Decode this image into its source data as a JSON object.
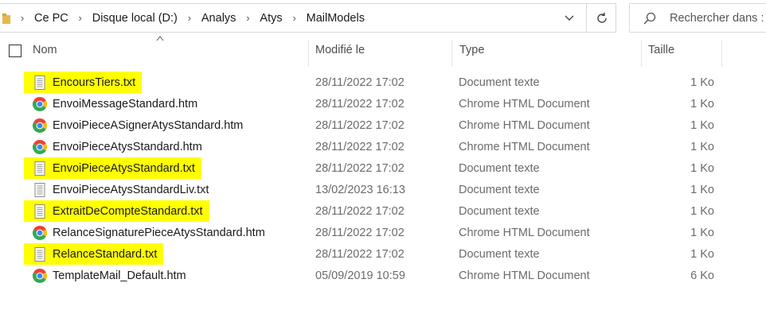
{
  "address_bar": {
    "breadcrumbs": [
      "Ce PC",
      "Disque local (D:)",
      "Analys",
      "Atys",
      "MailModels"
    ]
  },
  "search": {
    "placeholder": "Rechercher dans :"
  },
  "columns": {
    "name": "Nom",
    "modified": "Modifié le",
    "type": "Type",
    "size": "Taille"
  },
  "highlight_color": "#ffff00",
  "files": [
    {
      "name": "EncoursTiers.txt",
      "modified": "28/11/2022 17:02",
      "type": "Document texte",
      "size": "1 Ko",
      "icon": "text-document-icon",
      "highlighted": true
    },
    {
      "name": "EnvoiMessageStandard.htm",
      "modified": "28/11/2022 17:02",
      "type": "Chrome HTML Document",
      "size": "1 Ko",
      "icon": "chrome-icon",
      "highlighted": false
    },
    {
      "name": "EnvoiPieceASignerAtysStandard.htm",
      "modified": "28/11/2022 17:02",
      "type": "Chrome HTML Document",
      "size": "1 Ko",
      "icon": "chrome-icon",
      "highlighted": false
    },
    {
      "name": "EnvoiPieceAtysStandard.htm",
      "modified": "28/11/2022 17:02",
      "type": "Chrome HTML Document",
      "size": "1 Ko",
      "icon": "chrome-icon",
      "highlighted": false
    },
    {
      "name": "EnvoiPieceAtysStandard.txt",
      "modified": "28/11/2022 17:02",
      "type": "Document texte",
      "size": "1 Ko",
      "icon": "text-document-icon",
      "highlighted": true
    },
    {
      "name": "EnvoiPieceAtysStandardLiv.txt",
      "modified": "13/02/2023 16:13",
      "type": "Document texte",
      "size": "1 Ko",
      "icon": "text-document-icon",
      "highlighted": false
    },
    {
      "name": "ExtraitDeCompteStandard.txt",
      "modified": "28/11/2022 17:02",
      "type": "Document texte",
      "size": "1 Ko",
      "icon": "text-document-icon",
      "highlighted": true
    },
    {
      "name": "RelanceSignaturePieceAtysStandard.htm",
      "modified": "28/11/2022 17:02",
      "type": "Chrome HTML Document",
      "size": "1 Ko",
      "icon": "chrome-icon",
      "highlighted": false
    },
    {
      "name": "RelanceStandard.txt",
      "modified": "28/11/2022 17:02",
      "type": "Document texte",
      "size": "1 Ko",
      "icon": "text-document-icon",
      "highlighted": true
    },
    {
      "name": "TemplateMail_Default.htm",
      "modified": "05/09/2019 10:59",
      "type": "Chrome HTML Document",
      "size": "6 Ko",
      "icon": "chrome-icon",
      "highlighted": false
    }
  ]
}
